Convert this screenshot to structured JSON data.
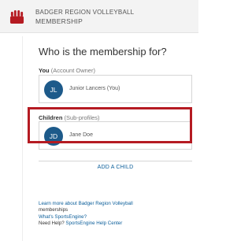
{
  "header": {
    "org_name": "BADGER REGION VOLLEYBALL",
    "subtitle": "MEMBERSHIP",
    "brand_color": "#b51b22"
  },
  "main": {
    "question": "Who is the membership for?",
    "you_section": {
      "label": "You",
      "hint": "(Account Owner)",
      "profile": {
        "initials": "JL",
        "name": "Junior Lancers (You)"
      }
    },
    "children_section": {
      "label": "Children",
      "hint": "(Sub-profiles)",
      "profile": {
        "initials": "JD",
        "name": "Jane Doe"
      }
    },
    "add_child_label": "ADD A CHILD"
  },
  "footer": {
    "learn_more_line1": "Learn more about Badger Region Volleyball",
    "learn_more_line2": "memberships",
    "whats_link": "What's SportsEngine?",
    "help_prefix": "Need Help?",
    "help_link": "SportsEngine Help Center"
  },
  "colors": {
    "avatar": "#1d5a8a",
    "link": "#0b5e9a",
    "highlight": "#b51b22"
  }
}
